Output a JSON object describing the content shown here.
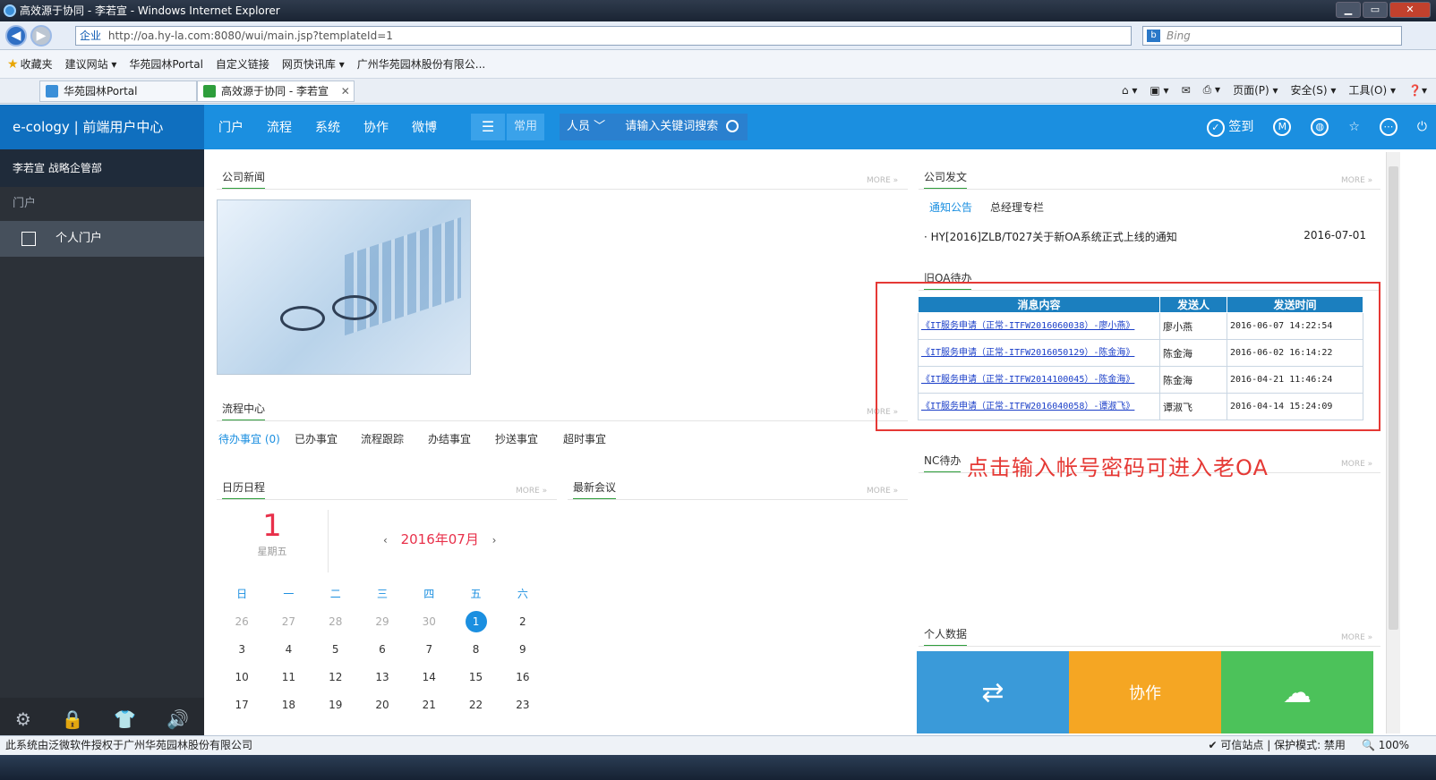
{
  "window": {
    "title": "高效源于协同 - 李若宣 - Windows Internet Explorer",
    "min": "▁",
    "max": "▭",
    "close": "✕"
  },
  "addressbar": {
    "zone": "企业",
    "url": "http://oa.hy-la.com:8080/wui/main.jsp?templateId=1",
    "search_placeholder": "Bing"
  },
  "favorites": {
    "label": "收藏夹",
    "items": [
      "建议网站 ▾",
      "华苑园林Portal",
      "自定义链接",
      "网页快讯库 ▾",
      "广州华苑园林股份有限公..."
    ]
  },
  "tabs": [
    {
      "label": "华苑园林Portal"
    },
    {
      "label": "高效源于协同 - 李若宣"
    }
  ],
  "toolbar": {
    "page": "页面(P) ▾",
    "safety": "安全(S) ▾",
    "tools": "工具(O) ▾"
  },
  "header": {
    "brand": "e-cology | 前端用户中心",
    "nav": [
      "门户",
      "流程",
      "系统",
      "协作",
      "微博"
    ],
    "menu_icon": "☰",
    "common": "常用",
    "search_scope": "人员 ﹀",
    "search_placeholder": "请输入关键词搜索",
    "signin": "签到"
  },
  "sidebar": {
    "user": "李若宣 战略企管部",
    "section": "门户",
    "item": "个人门户",
    "bottom_icons": [
      "⚙",
      "🔒",
      "👕",
      "🔊"
    ]
  },
  "panels": {
    "news_title": "公司新闻",
    "doc_title": "公司发文",
    "doc_tabs": [
      "通知公告",
      "总经理专栏"
    ],
    "notice": {
      "text": "· HY[2016]ZLB/T027关于新OA系统正式上线的通知",
      "date": "2016-07-01"
    },
    "old_oa_title": "旧OA待办",
    "flow_title": "流程中心",
    "flow_tabs": [
      "待办事宜 (0)",
      "已办事宜",
      "流程跟踪",
      "办结事宜",
      "抄送事宜",
      "超时事宜"
    ],
    "calendar_title": "日历日程",
    "meeting_title": "最新会议",
    "nc_title": "NC待办",
    "personal_title": "个人数据",
    "more": "MORE »"
  },
  "old_oa": {
    "headers": [
      "消息内容",
      "发送人",
      "发送时间"
    ],
    "rows": [
      {
        "content": "《IT服务申请（正常-ITFW2016060038）-廖小燕》",
        "sender": "廖小燕",
        "time": "2016-06-07 14:22:54"
      },
      {
        "content": "《IT服务申请（正常-ITFW2016050129）-陈金海》",
        "sender": "陈金海",
        "time": "2016-06-02 16:14:22"
      },
      {
        "content": "《IT服务申请（正常-ITFW2014100045）-陈金海》",
        "sender": "陈金海",
        "time": "2016-04-21 11:46:24"
      },
      {
        "content": "《IT服务申请（正常-ITFW2016040058）-谭淑飞》",
        "sender": "谭淑飞",
        "time": "2016-04-14 15:24:09"
      }
    ]
  },
  "annotation": "点击输入帐号密码可进入老OA",
  "calendar": {
    "day": "1",
    "weekday": "星期五",
    "month": "2016年07月",
    "prev": "‹",
    "next": "›",
    "weekdays": [
      "日",
      "一",
      "二",
      "三",
      "四",
      "五",
      "六"
    ],
    "weeks": [
      [
        "26",
        "27",
        "28",
        "29",
        "30",
        "1",
        "2"
      ],
      [
        "3",
        "4",
        "5",
        "6",
        "7",
        "8",
        "9"
      ],
      [
        "10",
        "11",
        "12",
        "13",
        "14",
        "15",
        "16"
      ],
      [
        "17",
        "18",
        "19",
        "20",
        "21",
        "22",
        "23"
      ]
    ]
  },
  "tiles": [
    {
      "label": "⇄",
      "color": "#3a9ad9"
    },
    {
      "label": "协作",
      "color": "#f5a623"
    },
    {
      "label": "☁",
      "color": "#4cc25a"
    }
  ],
  "status": {
    "left": "此系统由泛微软件授权于广州华苑园林股份有限公司",
    "site": "✔ 可信站点 | 保护模式: 禁用",
    "zoom": "🔍 100%"
  }
}
